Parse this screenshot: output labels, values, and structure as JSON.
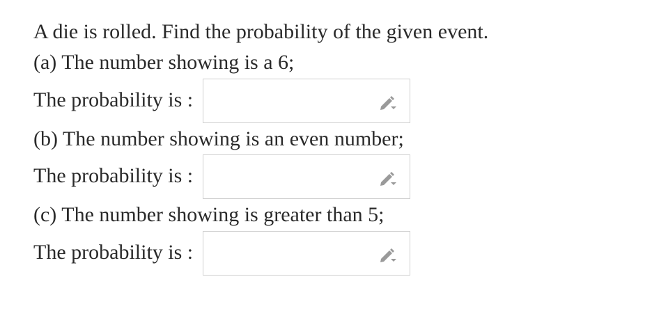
{
  "question": {
    "intro": "A die is rolled. Find the probability of the given event.",
    "parts": [
      {
        "text": "(a) The number showing is a 6;",
        "answer_label": "The probability is :",
        "answer_value": ""
      },
      {
        "text": "(b) The number showing is an even number;",
        "answer_label": "The probability is :",
        "answer_value": ""
      },
      {
        "text": "(c) The number showing is greater than 5;",
        "answer_label": "The probability is :",
        "answer_value": ""
      }
    ]
  },
  "icons": {
    "edit": "pencil-icon"
  },
  "colors": {
    "text": "#2a2a2a",
    "box_border": "#cfcfcf",
    "icon": "#9a9a9a"
  }
}
